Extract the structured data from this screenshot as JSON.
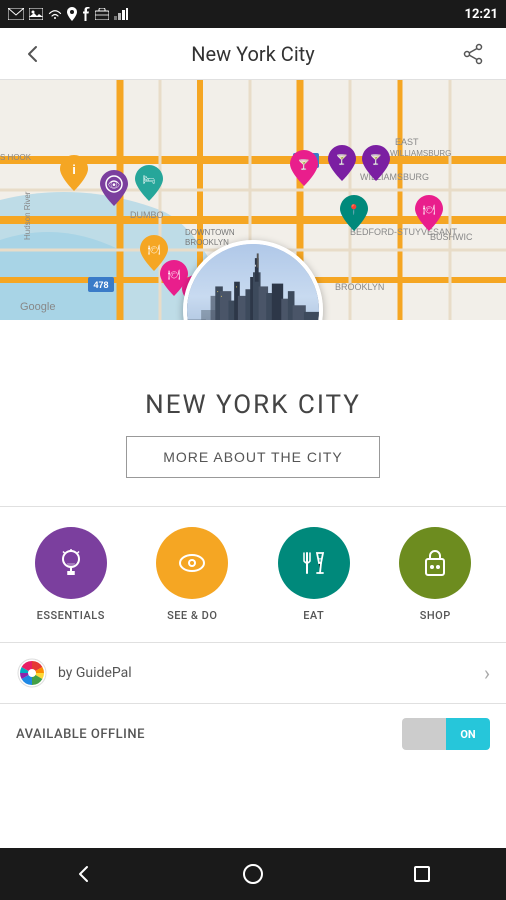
{
  "statusBar": {
    "time": "12:21",
    "icons": [
      "gmail",
      "image",
      "wifi",
      "location",
      "facebook",
      "briefcase"
    ]
  },
  "topBar": {
    "title": "New York City",
    "backLabel": "←",
    "shareLabel": "⬆"
  },
  "citySection": {
    "cityName": "NEW YORK CITY",
    "moreBtn": "MORE ABOUT THE CITY"
  },
  "categories": [
    {
      "id": "essentials",
      "label": "ESSENTIALS",
      "color": "#7b3f9e",
      "icon": "💡"
    },
    {
      "id": "see-do",
      "label": "SEE & DO",
      "color": "#f5a623",
      "icon": "👁"
    },
    {
      "id": "eat",
      "label": "EAT",
      "color": "#00897b",
      "icon": "🍽"
    },
    {
      "id": "shop",
      "label": "SHOP",
      "color": "#6d8c1f",
      "icon": "🛍"
    }
  ],
  "guidePal": {
    "prefix": "by ",
    "name": "GuidePal"
  },
  "offlineSection": {
    "label": "AVAILABLE OFFLINE",
    "toggleState": "ON"
  },
  "bottomNav": {
    "back": "◁",
    "home": "○",
    "square": "□"
  },
  "colors": {
    "essentials": "#7b3f9e",
    "seeDo": "#f5a623",
    "eat": "#00897b",
    "shop": "#6d8c1f",
    "toggleOn": "#26c6da",
    "toggleOff": "#cccccc"
  }
}
